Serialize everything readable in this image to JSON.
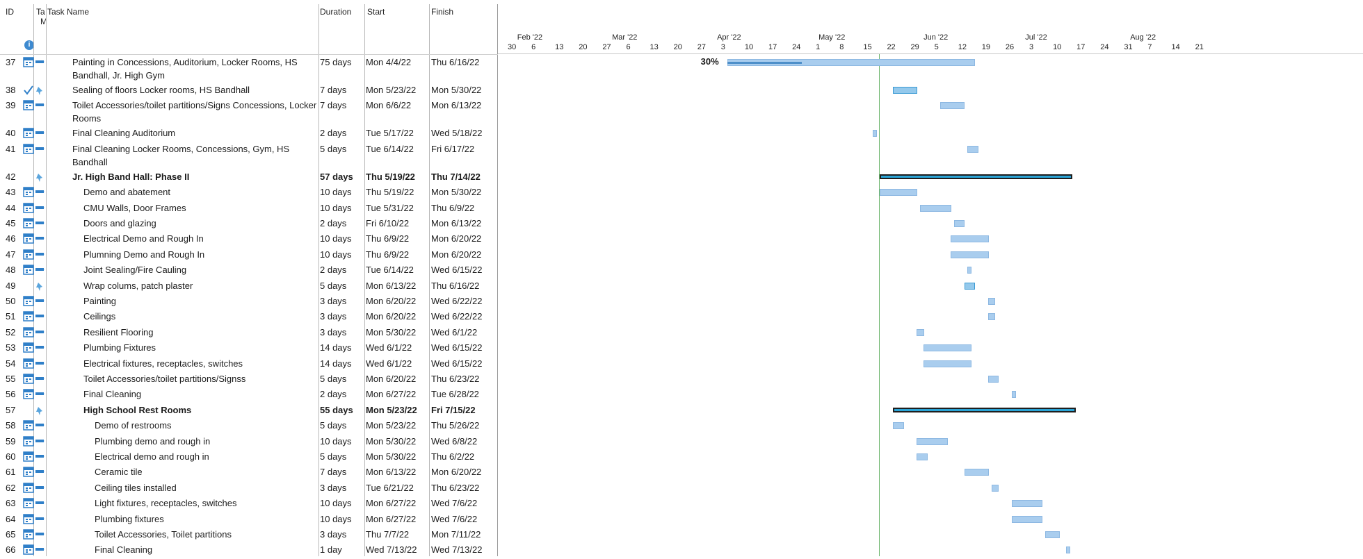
{
  "columns": {
    "id": "ID",
    "mode_a": "Ta",
    "mode_b": "M",
    "name": "Task Name",
    "duration": "Duration",
    "start": "Start",
    "finish": "Finish"
  },
  "timeline": {
    "months": [
      "Feb '22",
      "Mar '22",
      "Apr '22",
      "May '22",
      "Jun '22",
      "Jul '22",
      "Aug '22"
    ],
    "days": [
      "30",
      "6",
      "13",
      "20",
      "27",
      "6",
      "13",
      "20",
      "27",
      "3",
      "10",
      "17",
      "24",
      "1",
      "8",
      "15",
      "22",
      "29",
      "5",
      "12",
      "19",
      "26",
      "3",
      "10",
      "17",
      "24",
      "31",
      "7",
      "14",
      "21"
    ],
    "status_date_line": "May '22",
    "progress_label": "30%"
  },
  "colors": {
    "bar": "#a9cdee",
    "manual_bar": "#94c9ec",
    "summary_bar": "#2aa4d6",
    "status_line": "#6db56d"
  },
  "tasks": [
    {
      "id": "37",
      "icon": "calendar-icon",
      "name": "Painting in Concessions, Auditorium, Locker Rooms, HS Bandhall, Jr. High Gym",
      "duration": "75 days",
      "start": "Mon 4/4/22",
      "finish": "Thu 6/16/22",
      "bold": false,
      "indent": 0,
      "lines": 2
    },
    {
      "id": "38",
      "icon": "checkmark-icon",
      "name": "Sealing of floors Locker rooms, HS Bandhall",
      "duration": "7 days",
      "start": "Mon 5/23/22",
      "finish": "Mon 5/30/22",
      "bold": false,
      "indent": 0,
      "lines": 1
    },
    {
      "id": "39",
      "icon": "calendar-icon",
      "name": "Toilet Accessories/toilet partitions/Signs Concessions, Locker Rooms",
      "duration": "7 days",
      "start": "Mon 6/6/22",
      "finish": "Mon 6/13/22",
      "bold": false,
      "indent": 0,
      "lines": 2
    },
    {
      "id": "40",
      "icon": "calendar-icon",
      "name": "Final Cleaning Auditorium",
      "duration": "2 days",
      "start": "Tue 5/17/22",
      "finish": "Wed 5/18/22",
      "bold": false,
      "indent": 0,
      "lines": 1
    },
    {
      "id": "41",
      "icon": "calendar-icon",
      "name": "Final Cleaning Locker Rooms, Concessions, Gym, HS Bandhall",
      "duration": "5 days",
      "start": "Tue 6/14/22",
      "finish": "Fri 6/17/22",
      "bold": false,
      "indent": 0,
      "lines": 2
    },
    {
      "id": "42",
      "icon": "pin-icon",
      "name": "Jr. High Band Hall: Phase II",
      "duration": "57 days",
      "start": "Thu 5/19/22",
      "finish": "Thu 7/14/22",
      "bold": true,
      "indent": 0,
      "lines": 1
    },
    {
      "id": "43",
      "icon": "calendar-icon",
      "name": "Demo and abatement",
      "duration": "10 days",
      "start": "Thu 5/19/22",
      "finish": "Mon 5/30/22",
      "bold": false,
      "indent": 1,
      "lines": 1
    },
    {
      "id": "44",
      "icon": "calendar-icon",
      "name": "CMU Walls, Door Frames",
      "duration": "10 days",
      "start": "Tue 5/31/22",
      "finish": "Thu 6/9/22",
      "bold": false,
      "indent": 1,
      "lines": 1
    },
    {
      "id": "45",
      "icon": "calendar-icon",
      "name": "Doors and glazing",
      "duration": "2 days",
      "start": "Fri 6/10/22",
      "finish": "Mon 6/13/22",
      "bold": false,
      "indent": 1,
      "lines": 1
    },
    {
      "id": "46",
      "icon": "calendar-icon",
      "name": "Electrical Demo and Rough In",
      "duration": "10 days",
      "start": "Thu 6/9/22",
      "finish": "Mon 6/20/22",
      "bold": false,
      "indent": 1,
      "lines": 1
    },
    {
      "id": "47",
      "icon": "calendar-icon",
      "name": "Plumning Demo and Rough In",
      "duration": "10 days",
      "start": "Thu 6/9/22",
      "finish": "Mon 6/20/22",
      "bold": false,
      "indent": 1,
      "lines": 1
    },
    {
      "id": "48",
      "icon": "calendar-icon",
      "name": "Joint Sealing/Fire Cauling",
      "duration": "2 days",
      "start": "Tue 6/14/22",
      "finish": "Wed 6/15/22",
      "bold": false,
      "indent": 1,
      "lines": 1
    },
    {
      "id": "49",
      "icon": "pin-icon",
      "name": "Wrap colums, patch plaster",
      "duration": "5 days",
      "start": "Mon 6/13/22",
      "finish": "Thu 6/16/22",
      "bold": false,
      "indent": 1,
      "lines": 1
    },
    {
      "id": "50",
      "icon": "calendar-icon",
      "name": "Painting",
      "duration": "3 days",
      "start": "Mon 6/20/22",
      "finish": "Wed 6/22/22",
      "bold": false,
      "indent": 1,
      "lines": 1
    },
    {
      "id": "51",
      "icon": "calendar-icon",
      "name": "Ceilings",
      "duration": "3 days",
      "start": "Mon 6/20/22",
      "finish": "Wed 6/22/22",
      "bold": false,
      "indent": 1,
      "lines": 1
    },
    {
      "id": "52",
      "icon": "calendar-icon",
      "name": "Resilient Flooring",
      "duration": "3 days",
      "start": "Mon 5/30/22",
      "finish": "Wed 6/1/22",
      "bold": false,
      "indent": 1,
      "lines": 1
    },
    {
      "id": "53",
      "icon": "calendar-icon",
      "name": "Plumbing Fixtures",
      "duration": "14 days",
      "start": "Wed 6/1/22",
      "finish": "Wed 6/15/22",
      "bold": false,
      "indent": 1,
      "lines": 1
    },
    {
      "id": "54",
      "icon": "calendar-icon",
      "name": "Electrical fixtures, receptacles, switches",
      "duration": "14 days",
      "start": "Wed 6/1/22",
      "finish": "Wed 6/15/22",
      "bold": false,
      "indent": 1,
      "lines": 1
    },
    {
      "id": "55",
      "icon": "calendar-icon",
      "name": "Toilet Accessories/toilet partitions/Signss",
      "duration": "5 days",
      "start": "Mon 6/20/22",
      "finish": "Thu 6/23/22",
      "bold": false,
      "indent": 1,
      "lines": 1
    },
    {
      "id": "56",
      "icon": "calendar-icon",
      "name": "Final Cleaning",
      "duration": "2 days",
      "start": "Mon 6/27/22",
      "finish": "Tue 6/28/22",
      "bold": false,
      "indent": 1,
      "lines": 1
    },
    {
      "id": "57",
      "icon": "pin-icon",
      "name": "High School Rest Rooms",
      "duration": "55 days",
      "start": "Mon 5/23/22",
      "finish": "Fri 7/15/22",
      "bold": true,
      "indent": 1,
      "lines": 1
    },
    {
      "id": "58",
      "icon": "calendar-icon",
      "name": "Demo of restrooms",
      "duration": "5 days",
      "start": "Mon 5/23/22",
      "finish": "Thu 5/26/22",
      "bold": false,
      "indent": 2,
      "lines": 1
    },
    {
      "id": "59",
      "icon": "calendar-icon",
      "name": "Plumbing  demo and rough in",
      "duration": "10 days",
      "start": "Mon 5/30/22",
      "finish": "Wed 6/8/22",
      "bold": false,
      "indent": 2,
      "lines": 1
    },
    {
      "id": "60",
      "icon": "calendar-icon",
      "name": "Electrical demo and rough in",
      "duration": "5 days",
      "start": "Mon 5/30/22",
      "finish": "Thu 6/2/22",
      "bold": false,
      "indent": 2,
      "lines": 1
    },
    {
      "id": "61",
      "icon": "calendar-icon",
      "name": "Ceramic tile",
      "duration": "7 days",
      "start": "Mon 6/13/22",
      "finish": "Mon 6/20/22",
      "bold": false,
      "indent": 2,
      "lines": 1
    },
    {
      "id": "62",
      "icon": "calendar-icon",
      "name": "Ceiling tiles installed",
      "duration": "3 days",
      "start": "Tue 6/21/22",
      "finish": "Thu 6/23/22",
      "bold": false,
      "indent": 2,
      "lines": 1
    },
    {
      "id": "63",
      "icon": "calendar-icon",
      "name": "Light fixtures, receptacles, switches",
      "duration": "10 days",
      "start": "Mon 6/27/22",
      "finish": "Wed 7/6/22",
      "bold": false,
      "indent": 2,
      "lines": 1
    },
    {
      "id": "64",
      "icon": "calendar-icon",
      "name": "Plumbing fixtures",
      "duration": "10 days",
      "start": "Mon 6/27/22",
      "finish": "Wed 7/6/22",
      "bold": false,
      "indent": 2,
      "lines": 1
    },
    {
      "id": "65",
      "icon": "calendar-icon",
      "name": "Toilet Accessories, Toilet partitions",
      "duration": "3 days",
      "start": "Thu 7/7/22",
      "finish": "Mon 7/11/22",
      "bold": false,
      "indent": 2,
      "lines": 1
    },
    {
      "id": "66",
      "icon": "calendar-icon",
      "name": "Final Cleaning",
      "duration": "1 day",
      "start": "Wed 7/13/22",
      "finish": "Wed 7/13/22",
      "bold": false,
      "indent": 2,
      "lines": 1
    }
  ]
}
